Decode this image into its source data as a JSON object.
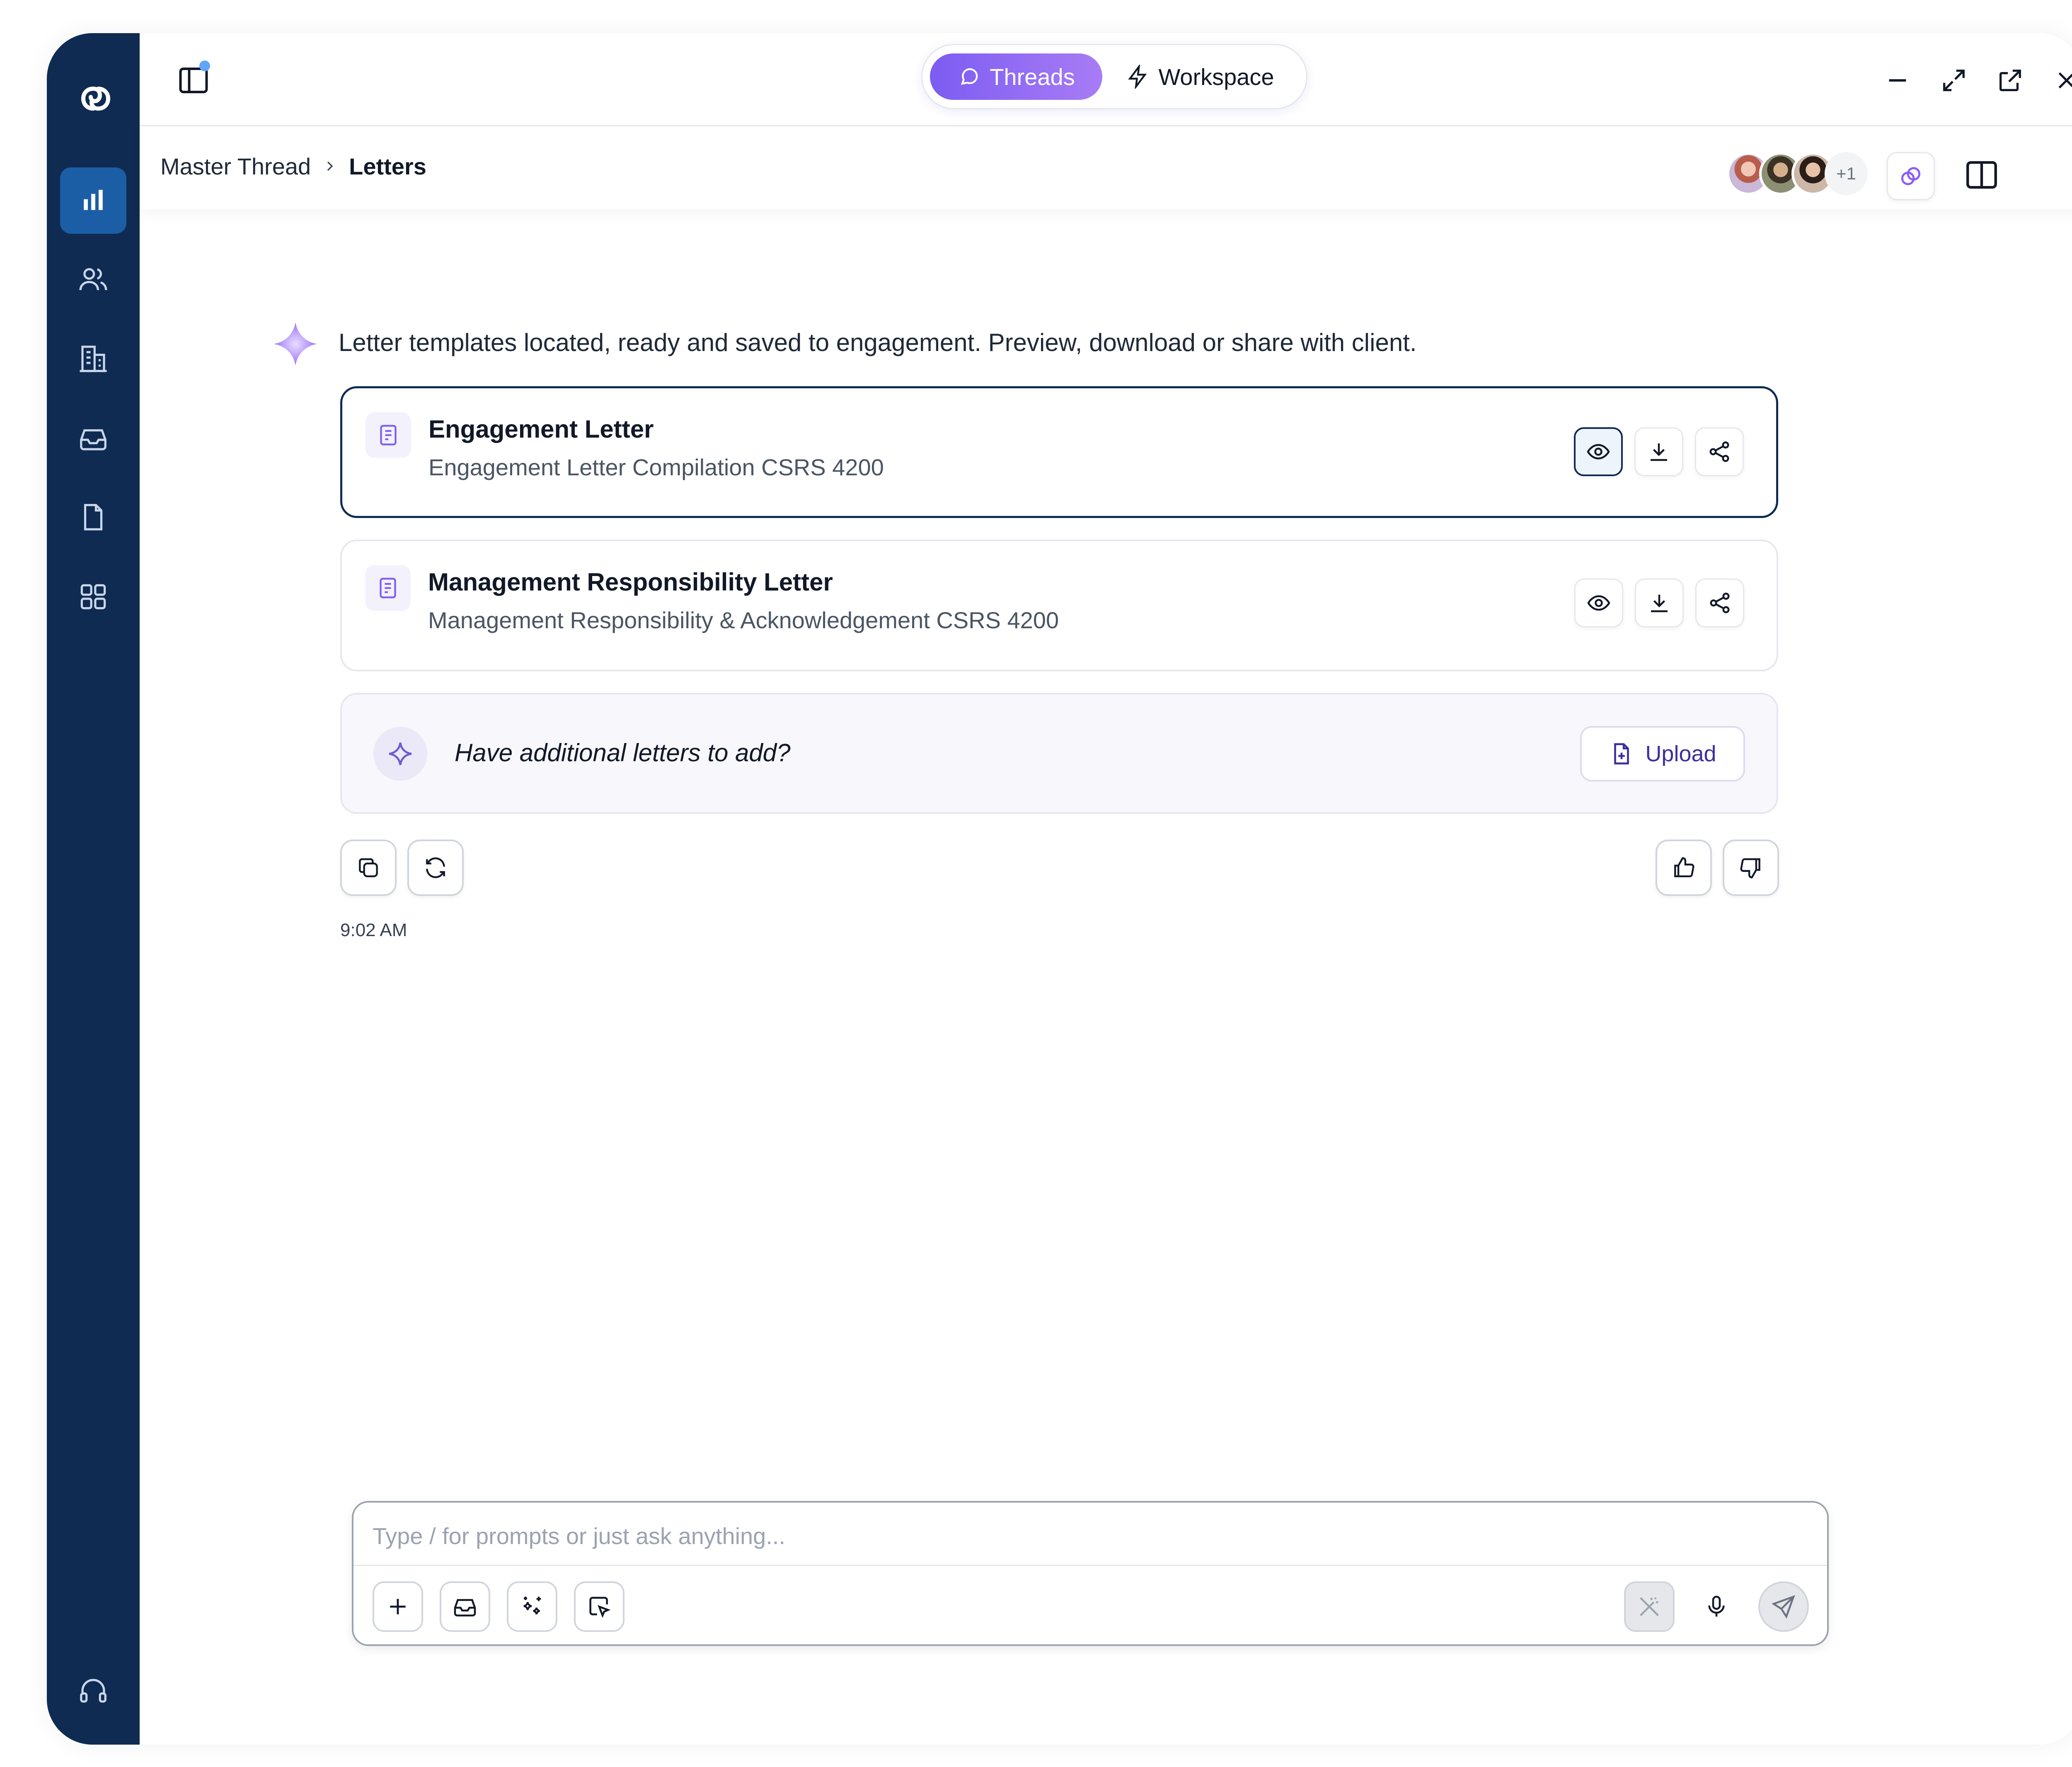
{
  "app": {
    "modes": [
      {
        "label": "Threads",
        "active": true,
        "icon": "chat-icon"
      },
      {
        "label": "Workspace",
        "active": false,
        "icon": "lightning-icon"
      }
    ]
  },
  "sidebar": {
    "logo": "brand-logo",
    "items": [
      {
        "name": "analytics",
        "icon": "bar-chart-icon",
        "active": true
      },
      {
        "name": "clients",
        "icon": "users-icon"
      },
      {
        "name": "companies",
        "icon": "building-icon"
      },
      {
        "name": "inbox",
        "icon": "inbox-icon"
      },
      {
        "name": "documents",
        "icon": "document-icon"
      },
      {
        "name": "apps",
        "icon": "grid-icon"
      },
      {
        "name": "support",
        "icon": "headset-icon"
      }
    ]
  },
  "breadcrumb": {
    "parent": "Master Thread",
    "current": "Letters"
  },
  "collaborators": {
    "extra_count": "+1"
  },
  "message": {
    "text": "Letter templates located, ready and saved to engagement. Preview, download or share with client.",
    "time": "9:02 AM"
  },
  "letters": [
    {
      "title": "Engagement Letter",
      "subtitle": "Engagement Letter Compilation CSRS 4200"
    },
    {
      "title": "Management Responsibility Letter",
      "subtitle": "Management Responsibility & Acknowledgement CSRS 4200"
    }
  ],
  "add_prompt": {
    "text": "Have additional letters to add?",
    "button": "Upload"
  },
  "composer": {
    "placeholder": "Type / for prompts or just ask anything..."
  },
  "colors": {
    "sidebar": "#0f2b52",
    "active_nav": "#1c5ea6",
    "accent": "#7c5cf2"
  }
}
